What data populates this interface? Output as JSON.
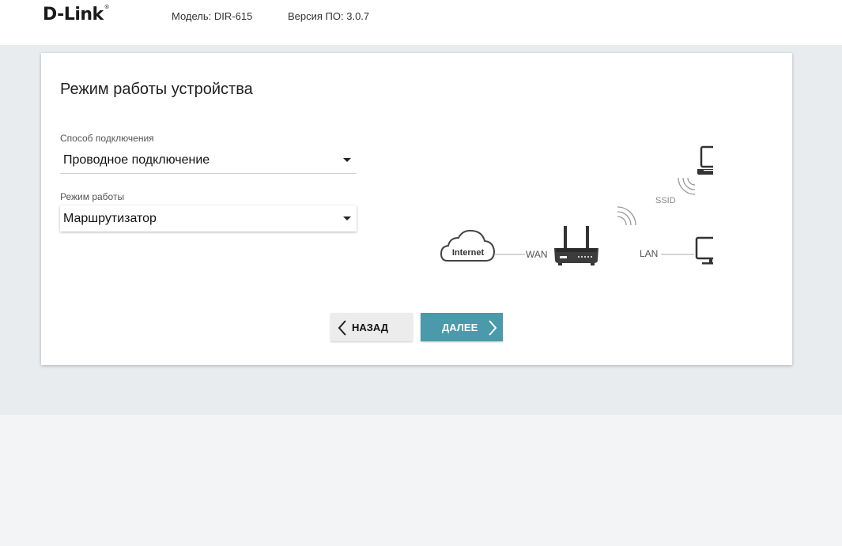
{
  "header": {
    "logo": "D-Link",
    "logo_mark": "®",
    "model": "Модель: DIR-615",
    "firmware": "Версия ПО: 3.0.7"
  },
  "page": {
    "title": "Режим работы устройства"
  },
  "form": {
    "connection": {
      "label": "Способ подключения",
      "value": "Проводное подключение"
    },
    "mode": {
      "label": "Режим работы",
      "value": "Маршрутизатор"
    }
  },
  "diagram": {
    "internet": "Internet",
    "wan": "WAN",
    "lan": "LAN",
    "ssid": "SSID"
  },
  "buttons": {
    "back": "НАЗАД",
    "next": "ДАЛЕЕ"
  },
  "colors": {
    "accent": "#4a9aac",
    "diagram": "#444444"
  }
}
